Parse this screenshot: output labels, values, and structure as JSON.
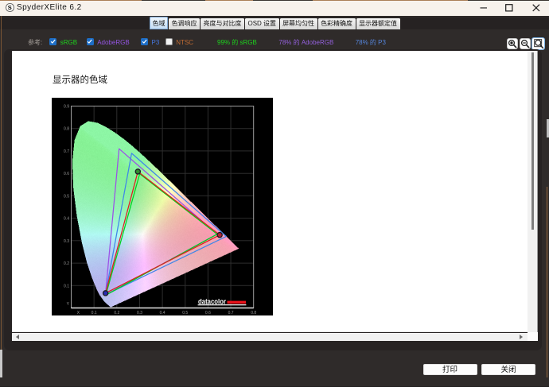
{
  "window": {
    "title": "SpyderXElite 6.2",
    "icon_letter": "S"
  },
  "tabs": [
    {
      "label": "色域",
      "active": true
    },
    {
      "label": "色调响应",
      "active": false
    },
    {
      "label": "亮度与对比度",
      "active": false
    },
    {
      "label": "OSD 设置",
      "active": false
    },
    {
      "label": "屏幕均匀性",
      "active": false
    },
    {
      "label": "色彩精确度",
      "active": false
    },
    {
      "label": "显示器额定值",
      "active": false
    }
  ],
  "toolbar": {
    "reference_label": "参考:",
    "checkboxes": [
      {
        "label": "sRGB",
        "checked": true,
        "color": "#1dd11d"
      },
      {
        "label": "AdobeRGB",
        "checked": true,
        "color": "#9455e2"
      },
      {
        "label": "P3",
        "checked": true,
        "color": "#4577e0"
      },
      {
        "label": "NTSC",
        "checked": false,
        "color": "#bf6a32"
      }
    ],
    "coverage": [
      {
        "text": "99% 的 sRGB",
        "color": "#1dd11d"
      },
      {
        "text": "78% 的 AdobeRGB",
        "color": "#9360db"
      },
      {
        "text": "78% 的 P3",
        "color": "#5585db"
      }
    ],
    "zoom_buttons": [
      {
        "name": "zoom-in",
        "selected": false
      },
      {
        "name": "zoom-out",
        "selected": false
      },
      {
        "name": "zoom-fit",
        "selected": true
      }
    ]
  },
  "document": {
    "heading": "显示器的色域"
  },
  "icons": {
    "app": "S-logo-circle",
    "window": [
      "minimize-icon",
      "maximize-icon",
      "close-icon"
    ],
    "toolbar": [
      "check-icon",
      "zoom-in-icon",
      "zoom-out-icon",
      "zoom-fit-icon"
    ],
    "scrollbar": [
      "scroll-left-arrow-icon",
      "scroll-right-arrow-icon"
    ]
  },
  "footer": {
    "print_label": "打印",
    "close_label": "关闭"
  },
  "chart_data": {
    "type": "chromaticity-diagram",
    "title": "显示器的色域",
    "xlabel": "X",
    "ylabel": "Y",
    "xlim": [
      0,
      0.8
    ],
    "ylim": [
      0,
      0.9
    ],
    "x_ticks": [
      {
        "v": 0.031,
        "t": "X"
      },
      {
        "v": 0.1,
        "t": "0.1"
      },
      {
        "v": 0.2,
        "t": "0.2"
      },
      {
        "v": 0.3,
        "t": "0.3"
      },
      {
        "v": 0.4,
        "t": "0.4"
      },
      {
        "v": 0.5,
        "t": "0.5"
      },
      {
        "v": 0.6,
        "t": "0.6"
      },
      {
        "v": 0.7,
        "t": "0.7"
      },
      {
        "v": 0.8,
        "t": "0.8"
      }
    ],
    "y_ticks": [
      {
        "v": 0.02,
        "t": "Y"
      },
      {
        "v": 0.1,
        "t": "0.1"
      },
      {
        "v": 0.2,
        "t": "0.2"
      },
      {
        "v": 0.3,
        "t": "0.3"
      },
      {
        "v": 0.4,
        "t": "0.4"
      },
      {
        "v": 0.5,
        "t": "0.5"
      },
      {
        "v": 0.6,
        "t": "0.6"
      },
      {
        "v": 0.7,
        "t": "0.7"
      },
      {
        "v": 0.8,
        "t": "0.8"
      },
      {
        "v": 0.9,
        "t": "0.9"
      }
    ],
    "grid": true,
    "background": "#000000",
    "series": [
      {
        "name": "sRGB",
        "color": "#00d21e",
        "red": [
          0.64,
          0.33
        ],
        "green": [
          0.3005,
          0.5985
        ],
        "blue": [
          0.1515,
          0.0585
        ]
      },
      {
        "name": "AdobeRGB",
        "color": "#9b50e8",
        "red": [
          0.64,
          0.33
        ],
        "green": [
          0.21,
          0.71
        ],
        "blue": [
          0.15,
          0.06
        ]
      },
      {
        "name": "P3",
        "color": "#3f86e8",
        "red": [
          0.68,
          0.32
        ],
        "green": [
          0.265,
          0.69
        ],
        "blue": [
          0.15,
          0.06
        ]
      },
      {
        "name": "display",
        "color": "#e01e1e",
        "red": [
          0.6515,
          0.3265
        ],
        "green": [
          0.2925,
          0.6085
        ],
        "blue": [
          0.1505,
          0.0675
        ],
        "markers": {
          "red": "#b42432",
          "green": "#2f8b30",
          "blue": "#2a2cb0",
          "ring": "#1c1c22"
        }
      }
    ],
    "draw_order": [
      "AdobeRGB",
      "P3",
      "sRGB",
      "display"
    ],
    "coverage": [
      {
        "gamut": "sRGB",
        "percent": 99
      },
      {
        "gamut": "AdobeRGB",
        "percent": 78
      },
      {
        "gamut": "P3",
        "percent": 78
      }
    ],
    "logo": {
      "text": "datacolor",
      "bar_color": "#e8131c"
    },
    "spectral_locus": [
      [
        380,
        0.1741,
        0.005
      ],
      [
        390,
        0.1738,
        0.0049
      ],
      [
        400,
        0.1733,
        0.0048
      ],
      [
        410,
        0.1726,
        0.0048
      ],
      [
        420,
        0.1714,
        0.0051
      ],
      [
        430,
        0.1689,
        0.0069
      ],
      [
        440,
        0.1644,
        0.0109
      ],
      [
        450,
        0.1566,
        0.0177
      ],
      [
        460,
        0.144,
        0.0297
      ],
      [
        470,
        0.1241,
        0.0578
      ],
      [
        475,
        0.1096,
        0.0868
      ],
      [
        480,
        0.0913,
        0.1327
      ],
      [
        485,
        0.0687,
        0.2007
      ],
      [
        490,
        0.0454,
        0.295
      ],
      [
        495,
        0.0235,
        0.4127
      ],
      [
        500,
        0.0082,
        0.5384
      ],
      [
        505,
        0.0039,
        0.6548
      ],
      [
        510,
        0.0139,
        0.7502
      ],
      [
        515,
        0.0389,
        0.812
      ],
      [
        520,
        0.0743,
        0.8338
      ],
      [
        525,
        0.1142,
        0.8262
      ],
      [
        530,
        0.1547,
        0.8059
      ],
      [
        535,
        0.1929,
        0.7816
      ],
      [
        540,
        0.2296,
        0.7543
      ],
      [
        545,
        0.2658,
        0.7243
      ],
      [
        550,
        0.3016,
        0.6923
      ],
      [
        555,
        0.3373,
        0.6589
      ],
      [
        560,
        0.3731,
        0.6245
      ],
      [
        565,
        0.4087,
        0.5896
      ],
      [
        570,
        0.4441,
        0.5547
      ],
      [
        575,
        0.4788,
        0.5202
      ],
      [
        580,
        0.5125,
        0.4866
      ],
      [
        585,
        0.5448,
        0.4544
      ],
      [
        590,
        0.5752,
        0.4242
      ],
      [
        595,
        0.6029,
        0.3965
      ],
      [
        600,
        0.627,
        0.3725
      ],
      [
        605,
        0.6482,
        0.3514
      ],
      [
        610,
        0.6658,
        0.334
      ],
      [
        615,
        0.6801,
        0.3197
      ],
      [
        620,
        0.6915,
        0.3083
      ],
      [
        630,
        0.7079,
        0.292
      ],
      [
        640,
        0.719,
        0.2809
      ],
      [
        650,
        0.726,
        0.274
      ],
      [
        660,
        0.73,
        0.27
      ],
      [
        670,
        0.732,
        0.268
      ],
      [
        680,
        0.7334,
        0.2666
      ],
      [
        690,
        0.7344,
        0.2656
      ],
      [
        700,
        0.7347,
        0.2653
      ]
    ]
  }
}
